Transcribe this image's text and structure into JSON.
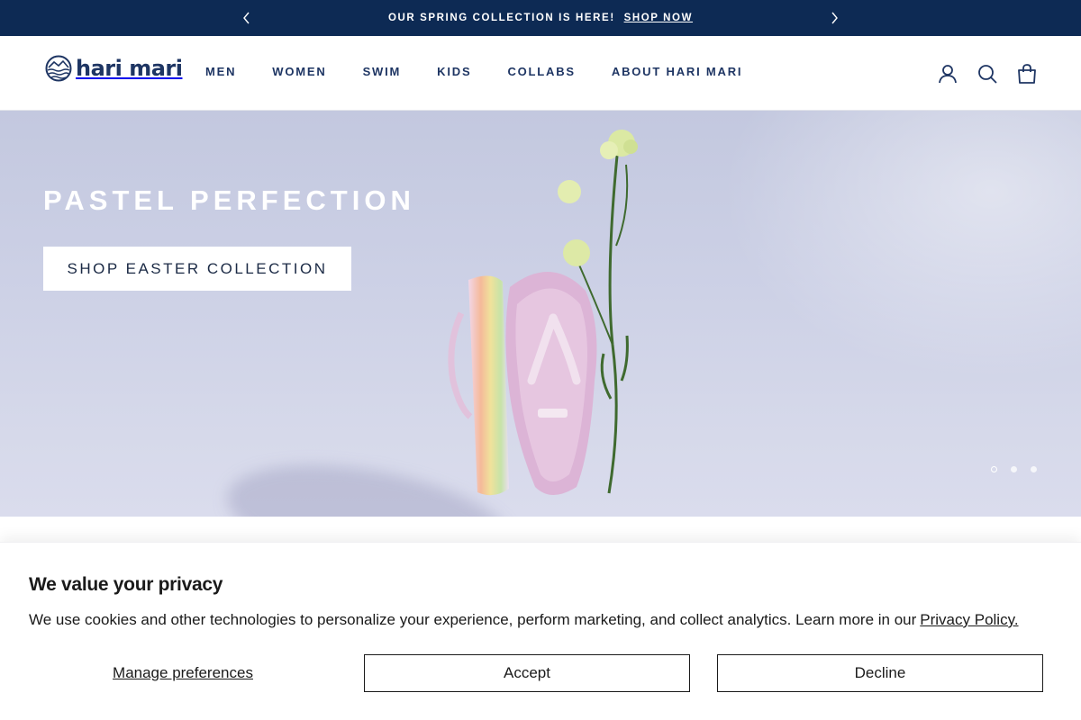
{
  "announcement": {
    "message": "OUR SPRING COLLECTION IS HERE!",
    "link": "SHOP NOW",
    "prev_icon": "chevron-left-icon",
    "next_icon": "chevron-right-icon"
  },
  "header": {
    "logo_text": "hari mari",
    "nav": [
      "MEN",
      "WOMEN",
      "SWIM",
      "KIDS",
      "COLLABS",
      "ABOUT HARI MARI"
    ],
    "icons": [
      "account-icon",
      "search-icon",
      "cart-icon"
    ]
  },
  "hero": {
    "title": "PASTEL PERFECTION",
    "button": "SHOP EASTER COLLECTION",
    "slide_count": 3,
    "active_slide": 1
  },
  "cookie": {
    "title": "We value your privacy",
    "text": "We use cookies and other technologies to personalize your experience, perform marketing, and collect analytics. Learn more in our",
    "policy_link": "Privacy Policy.",
    "manage": "Manage preferences",
    "accept": "Accept",
    "decline": "Decline"
  },
  "colors": {
    "announcement_bg": "#0d2a54",
    "brand_navy": "#1e3563",
    "hero_bg": "#cdd1e6"
  }
}
